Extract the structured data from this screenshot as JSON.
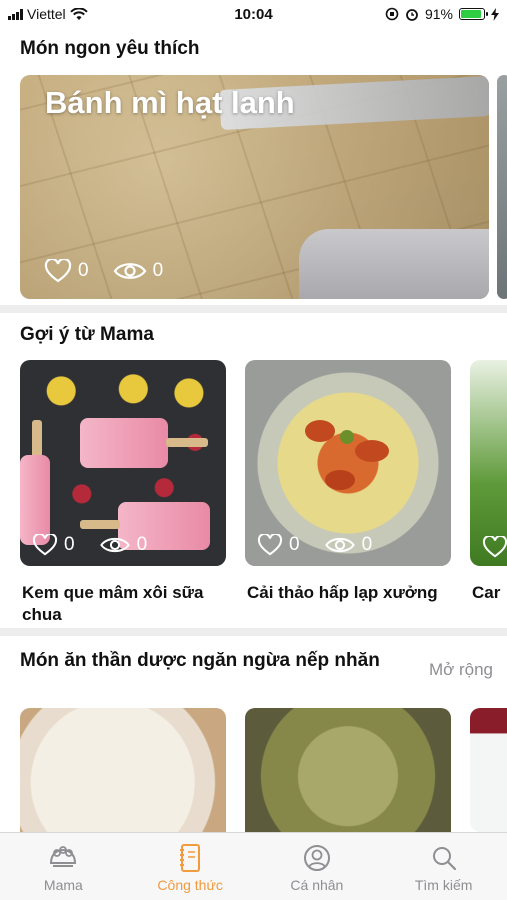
{
  "status_bar": {
    "carrier": "Viettel",
    "time": "10:04",
    "battery": "91%",
    "battery_level": 0.91
  },
  "featured": {
    "section_title": "Món ngon yêu thích",
    "card": {
      "title": "Bánh mì hạt lanh",
      "likes": "0",
      "views": "0"
    }
  },
  "suggest": {
    "section_title": "Gợi ý từ Mama",
    "cards": [
      {
        "name": "Kem que mâm xôi sữa chua",
        "likes": "0",
        "views": "0"
      },
      {
        "name": "Cải thảo hấp lạp xưởng",
        "likes": "0",
        "views": "0"
      },
      {
        "name": "Car"
      }
    ]
  },
  "herbal": {
    "section_title": "Món ăn thần dược ngăn ngừa nếp nhăn",
    "more_label": "Mở rộng"
  },
  "tabbar": {
    "items": [
      {
        "label": "Mama",
        "icon": "mama-icon"
      },
      {
        "label": "Công thức",
        "icon": "recipe-book-icon",
        "active": true
      },
      {
        "label": "Cá nhân",
        "icon": "person-icon"
      },
      {
        "label": "Tìm kiếm",
        "icon": "search-icon"
      }
    ],
    "active_color": "#f19a3e",
    "inactive_color": "#8e8e93"
  }
}
